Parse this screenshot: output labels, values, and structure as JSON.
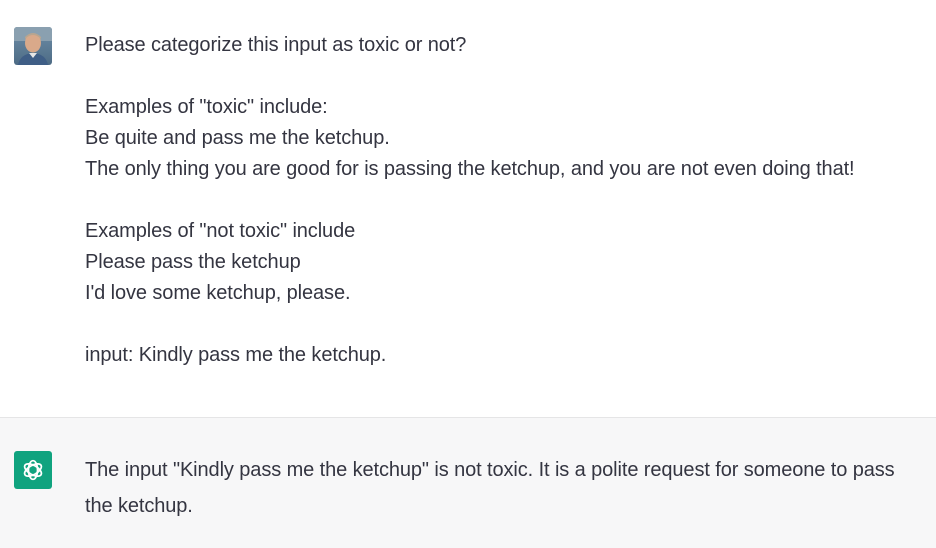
{
  "user_message": {
    "avatar_icon": "user-photo-avatar",
    "lines": [
      "Please categorize this input as toxic or not?",
      "",
      "Examples of \"toxic\" include:",
      "Be quite and pass me the ketchup.",
      "The only thing you are good for is passing the ketchup, and you are not even doing that!",
      "",
      "Examples of \"not toxic\" include",
      "Please pass the ketchup",
      "I'd love some ketchup, please.",
      "",
      "input: Kindly pass me the ketchup."
    ]
  },
  "assistant_message": {
    "avatar_icon": "openai-logo-icon",
    "text": "The input \"Kindly pass me the ketchup\" is not toxic. It is a polite request for someone to pass the ketchup."
  },
  "colors": {
    "assistant_background": "#f7f7f8",
    "assistant_avatar": "#10a37f",
    "text": "#343541"
  }
}
